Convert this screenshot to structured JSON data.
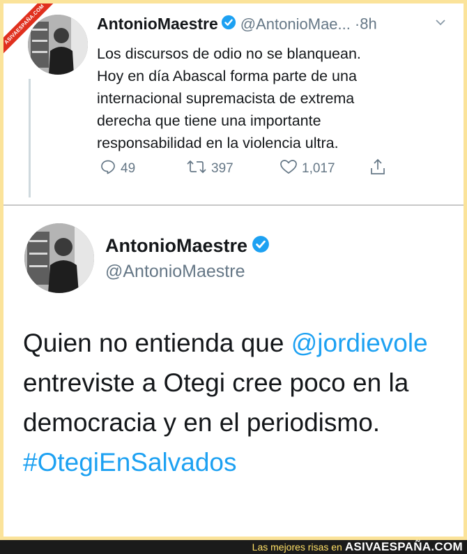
{
  "top_tweet": {
    "name": "AntonioMaestre",
    "handle": "@AntonioMae...",
    "separator": "·",
    "time": "8h",
    "text_lines": [
      "Los discursos de odio no se blanquean.",
      "Hoy en día Abascal forma parte de una",
      "internacional supremacista de extrema",
      "derecha que tiene una importante",
      "responsabilidad en la violencia ultra."
    ],
    "actions": {
      "replies": "49",
      "retweets": "397",
      "likes": "1,017"
    }
  },
  "main_tweet": {
    "name": "AntonioMaestre",
    "handle": "@AntonioMaestre",
    "text": {
      "part1": "Quien no entienda que ",
      "mention": "@jordievole",
      "part2": "entreviste a Otegi cree poco en la",
      "part3": "democracia y en el periodismo.",
      "hashtag": "#OtegiEnSalvados"
    }
  },
  "watermark": "ASIVAESPAÑA.COM",
  "footer": {
    "tagline": "Las mejores risas en",
    "brand": "ASIVAESPAÑA.COM"
  },
  "colors": {
    "link": "#1da1f2",
    "verified": "#1da1f2",
    "frame": "#fbe39a",
    "footer_bg": "#1b1b1b"
  }
}
